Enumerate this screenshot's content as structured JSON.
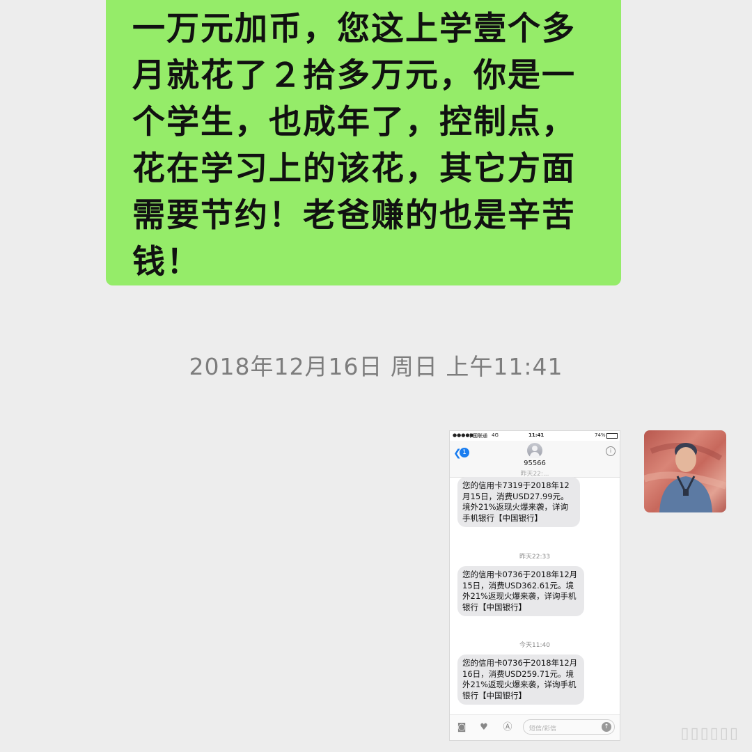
{
  "chat": {
    "incoming_message": "一万元加币，您这上学壹个多月就花了２拾多万元，你是一个学生，也成年了，控制点，花在学习上的该花，其它方面需要节约！老爸赚的也是辛苦钱！",
    "timestamp": "2018年12月16日 周日 上午11:41",
    "colors": {
      "bubble_green": "#95ec69",
      "background": "#ededed"
    }
  },
  "phone": {
    "status": {
      "carrier": "中国联通",
      "network": "4G",
      "time": "11:41",
      "battery": "74%"
    },
    "nav": {
      "back_badge": "1",
      "contact": "95566"
    },
    "messages": [
      {
        "time": "昨天22:...",
        "text": "您的信用卡7319于2018年12月15日，消费USD27.99元。境外21%返现火爆来袭，详询手机银行【中国银行】"
      },
      {
        "time": "昨天22:33",
        "text": "您的信用卡0736于2018年12月15日，消费USD362.61元。境外21%返现火爆来袭，详询手机银行【中国银行】"
      },
      {
        "time": "今天11:40",
        "text": "您的信用卡0736于2018年12月16日，消费USD259.71元。境外21%返现火爆来袭，详询手机银行【中国银行】"
      }
    ],
    "input": {
      "placeholder": "短信/彩信"
    }
  }
}
